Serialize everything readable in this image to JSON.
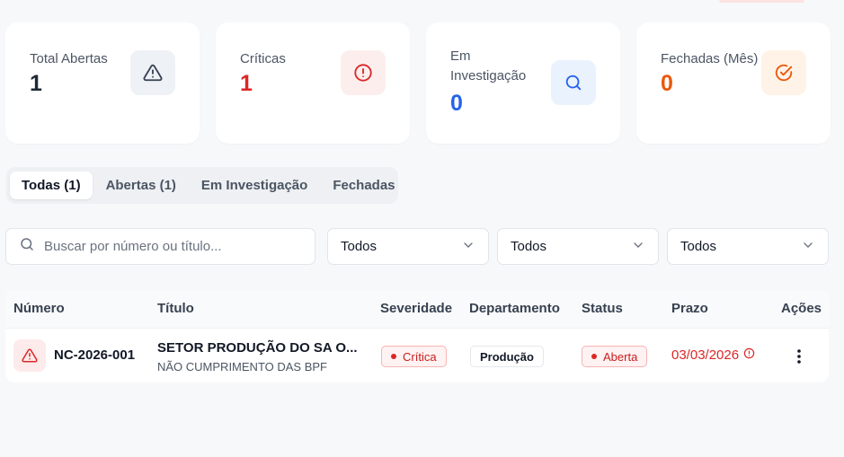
{
  "stats": [
    {
      "label": "Total Abertas",
      "value": "1",
      "color": "#1f2937",
      "icon": "alert-triangle-icon",
      "icon_bg": "#eef1f6"
    },
    {
      "label": "Críticas",
      "value": "1",
      "color": "#dc2626",
      "icon": "alert-circle-icon",
      "icon_bg": "#fdeeee"
    },
    {
      "label": "Em Investigação",
      "value": "0",
      "color": "#2563eb",
      "icon": "search-icon",
      "icon_bg": "#eaf2fe"
    },
    {
      "label": "Fechadas (Mês)",
      "value": "0",
      "color": "#ea580c",
      "icon": "check-circle-icon",
      "icon_bg": "#fff3e8"
    }
  ],
  "tabs": [
    "Todas (1)",
    "Abertas (1)",
    "Em Investigação",
    "Fechadas"
  ],
  "search": {
    "placeholder": "Buscar por número ou título..."
  },
  "filters": [
    "Todos",
    "Todos",
    "Todos"
  ],
  "table": {
    "headers": [
      "Número",
      "Título",
      "Severidade",
      "Departamento",
      "Status",
      "Prazo",
      "Ações"
    ],
    "rows": [
      {
        "numero": "NC-2026-001",
        "titulo": "SETOR PRODUÇÃO DO SA O...",
        "subtitulo": "NÃO CUMPRIMENTO DAS BPF",
        "severidade": "Crítica",
        "departamento": "Produção",
        "status": "Aberta",
        "prazo": "03/03/2026"
      }
    ]
  }
}
